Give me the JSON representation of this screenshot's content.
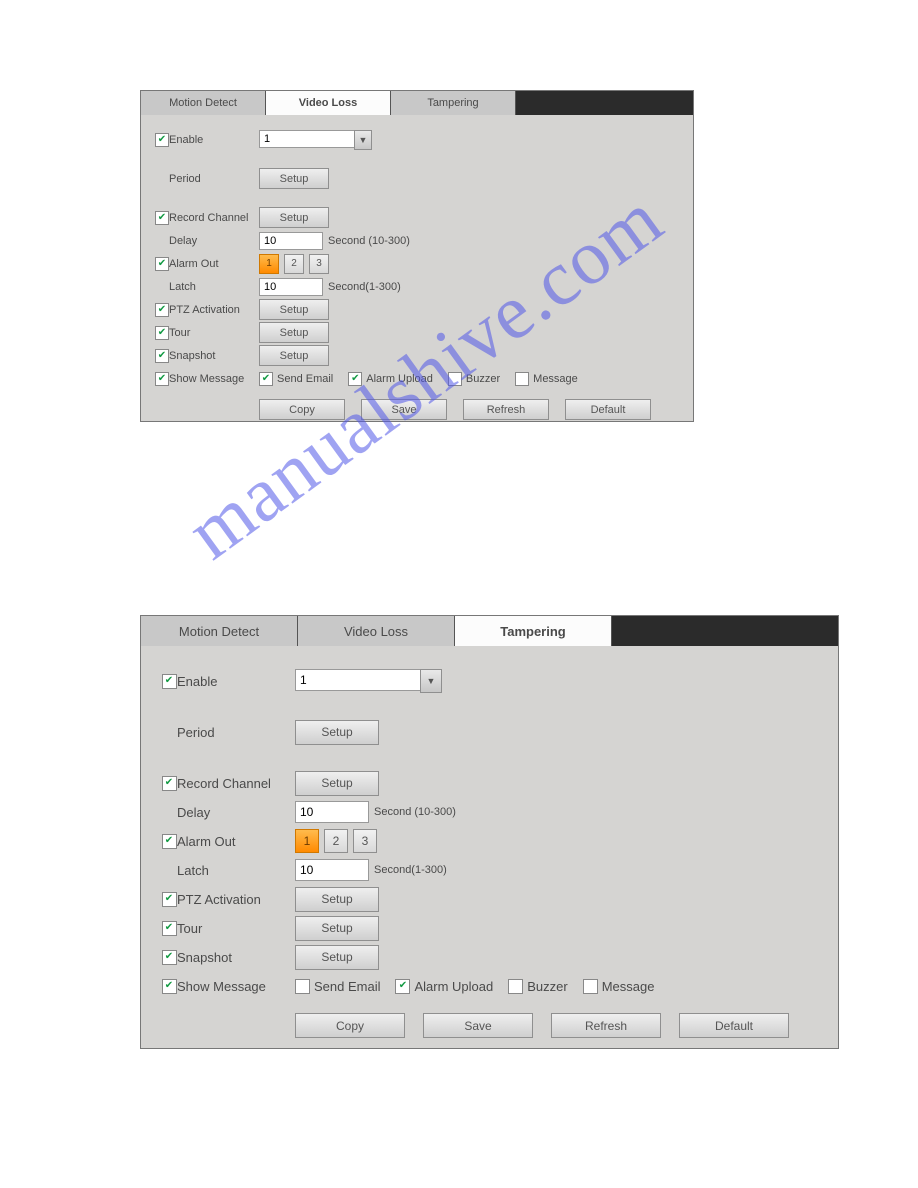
{
  "watermark": "manualshive.com",
  "common": {
    "tabs": {
      "motion": "Motion Detect",
      "videoLoss": "Video Loss",
      "tampering": "Tampering"
    },
    "labels": {
      "enable": "Enable",
      "period": "Period",
      "recordChannel": "Record Channel",
      "delay": "Delay",
      "alarmOut": "Alarm Out",
      "latch": "Latch",
      "ptz": "PTZ Activation",
      "tour": "Tour",
      "snapshot": "Snapshot",
      "showMessage": "Show Message",
      "sendEmail": "Send Email",
      "alarmUpload": "Alarm Upload",
      "buzzer": "Buzzer",
      "message": "Message"
    },
    "units": {
      "delay": "Second (10-300)",
      "latch": "Second(1-300)"
    },
    "buttons": {
      "setup": "Setup",
      "copy": "Copy",
      "save": "Save",
      "refresh": "Refresh",
      "default": "Default"
    },
    "alarmOutChannels": [
      "1",
      "2",
      "3"
    ]
  },
  "panel1": {
    "activeTab": "Video Loss",
    "enable": {
      "checked": true,
      "channel": "1"
    },
    "recordChannel": {
      "checked": true
    },
    "delay": "10",
    "alarmOut": {
      "checked": true,
      "selected": "1"
    },
    "latch": "10",
    "ptz": {
      "checked": true
    },
    "tour": {
      "checked": true
    },
    "snapshot": {
      "checked": true
    },
    "showMessage": {
      "checked": true,
      "sendEmail": true,
      "alarmUpload": true,
      "buzzer": false,
      "message": false
    }
  },
  "panel2": {
    "activeTab": "Tampering",
    "enable": {
      "checked": true,
      "channel": "1"
    },
    "recordChannel": {
      "checked": true
    },
    "delay": "10",
    "alarmOut": {
      "checked": true,
      "selected": "1"
    },
    "latch": "10",
    "ptz": {
      "checked": true
    },
    "tour": {
      "checked": true
    },
    "snapshot": {
      "checked": true
    },
    "showMessage": {
      "checked": true,
      "sendEmail": false,
      "alarmUpload": true,
      "buzzer": false,
      "message": false
    }
  }
}
